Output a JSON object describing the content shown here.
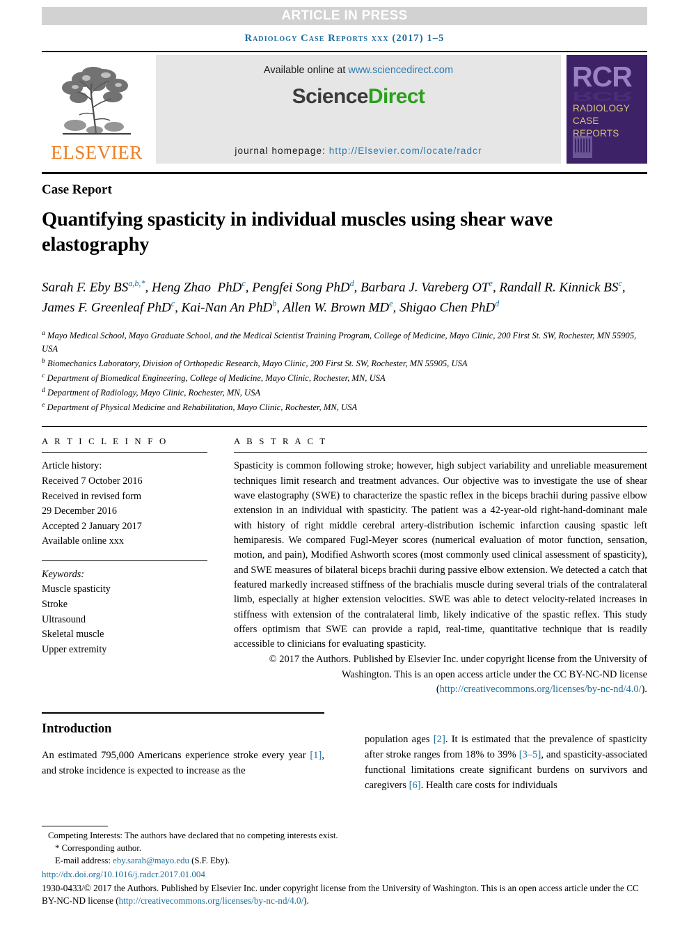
{
  "banner": {
    "text": "ARTICLE IN PRESS"
  },
  "running_head": {
    "text": "Radiology Case Reports xxx (2017) 1–5"
  },
  "masthead": {
    "elsevier": {
      "wordmark": "ELSEVIER"
    },
    "sciencedirect": {
      "available_prefix": "Available online at ",
      "available_link": "www.sciencedirect.com",
      "wordmark_part1": "Science",
      "wordmark_part2": "Direct",
      "homepage_label": "journal homepage: ",
      "homepage_link": "http://Elsevier.com/locate/radcr"
    },
    "rcr_cover": {
      "acronym": "RCR",
      "line1": "RADIOLOGY",
      "line2": "CASE",
      "line3": "REPORTS"
    }
  },
  "article": {
    "type_label": "Case Report",
    "title": "Quantifying spasticity in individual muscles using shear wave elastography",
    "authors_html": "Sarah F. Eby BS<sup>a,b,*</sup>, Heng Zhao&nbsp; PhD<sup>c</sup>, Pengfei Song PhD<sup>d</sup>, Barbara J. Vareberg OT<sup>e</sup>, Randall R. Kinnick BS<sup>c</sup>, James F. Greenleaf PhD<sup>c</sup>, Kai-Nan An PhD<sup>b</sup>, Allen W. Brown MD<sup>e</sup>, Shigao Chen PhD<sup>d</sup>",
    "affiliations": [
      {
        "marker": "a",
        "text": "Mayo Medical School, Mayo Graduate School, and the Medical Scientist Training Program, College of Medicine, Mayo Clinic, 200 First St. SW, Rochester, MN 55905, USA"
      },
      {
        "marker": "b",
        "text": "Biomechanics Laboratory, Division of Orthopedic Research, Mayo Clinic, 200 First St. SW, Rochester, MN 55905, USA"
      },
      {
        "marker": "c",
        "text": "Department of Biomedical Engineering, College of Medicine, Mayo Clinic, Rochester, MN, USA"
      },
      {
        "marker": "d",
        "text": "Department of Radiology, Mayo Clinic, Rochester, MN, USA"
      },
      {
        "marker": "e",
        "text": "Department of Physical Medicine and Rehabilitation, Mayo Clinic, Rochester, MN, USA"
      }
    ]
  },
  "article_info": {
    "heading": "A R T I C L E   I N F O",
    "history_label": "Article history:",
    "history": [
      "Received 7 October 2016",
      "Received in revised form",
      "29 December 2016",
      "Accepted 2 January 2017",
      "Available online xxx"
    ],
    "keywords_label": "Keywords:",
    "keywords": [
      "Muscle spasticity",
      "Stroke",
      "Ultrasound",
      "Skeletal muscle",
      "Upper extremity"
    ]
  },
  "abstract": {
    "heading": "A B S T R A C T",
    "body": "Spasticity is common following stroke; however, high subject variability and unreliable measurement techniques limit research and treatment advances. Our objective was to investigate the use of shear wave elastography (SWE) to characterize the spastic reflex in the biceps brachii during passive elbow extension in an individual with spasticity. The patient was a 42-year-old right-hand-dominant male with history of right middle cerebral artery-distribution ischemic infarction causing spastic left hemiparesis. We compared Fugl-Meyer scores (numerical evaluation of motor function, sensation, motion, and pain), Modified Ashworth scores (most commonly used clinical assessment of spasticity), and SWE measures of bilateral biceps brachii during passive elbow extension. We detected a catch that featured markedly increased stiffness of the brachialis muscle during several trials of the contralateral limb, especially at higher extension velocities. SWE was able to detect velocity-related increases in stiffness with extension of the contralateral limb, likely indicative of the spastic reflex. This study offers optimism that SWE can provide a rapid, real-time, quantitative technique that is readily accessible to clinicians for evaluating spasticity.",
    "copyright_text": "© 2017 the Authors. Published by Elsevier Inc. under copyright license from the University of Washington. This is an open access article under the CC BY-NC-ND license (",
    "copyright_link": "http://creativecommons.org/licenses/by-nc-nd/4.0/",
    "copyright_tail": ")."
  },
  "introduction": {
    "heading": "Introduction",
    "left_paragraph_html": "An estimated 795,000 Americans experience stroke every year <a class=\"lnk\" href=\"#\">[1]</a>, and stroke incidence is expected to increase as the",
    "right_paragraph_html": "population ages <a class=\"lnk\" href=\"#\">[2]</a>. It is estimated that the prevalence of spasticity after stroke ranges from 18% to 39% <a class=\"lnk\" href=\"#\">[3–5]</a>, and spasticity-associated functional limitations create significant burdens on survivors and caregivers <a class=\"lnk\" href=\"#\">[6]</a>. Health care costs for individuals"
  },
  "footnotes": {
    "competing": "Competing Interests: The authors have declared that no competing interests exist.",
    "corresponding": "* Corresponding author.",
    "email_label": "E-mail address: ",
    "email": "eby.sarah@mayo.edu",
    "email_suffix": " (S.F. Eby).",
    "doi": "http://dx.doi.org/10.1016/j.radcr.2017.01.004",
    "issn_copyright_pre": "1930-0433/© 2017 the Authors. Published by Elsevier Inc. under copyright license from the University of Washington. This is an open access article under the CC BY-NC-ND license (",
    "issn_copyright_link": "http://creativecommons.org/licenses/by-nc-nd/4.0/",
    "issn_copyright_post": ")."
  },
  "colors": {
    "link": "#1b6e9e",
    "banner_bg": "#d2d2d2",
    "sd_green": "#2aa11c",
    "elsevier_orange": "#ef7d22",
    "rcr_purple": "#3d2268",
    "rcr_gold": "#d8c37a"
  }
}
